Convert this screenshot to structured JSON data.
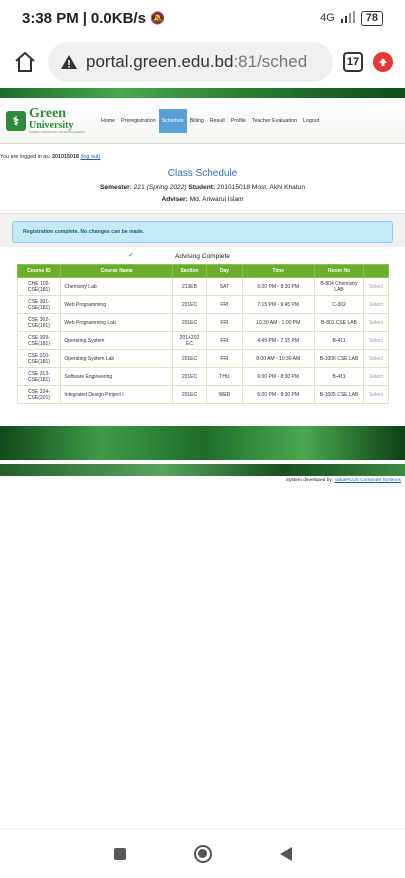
{
  "status": {
    "time": "3:38 PM",
    "speed": "0.0KB/s",
    "network": "4G",
    "battery": "78"
  },
  "browser": {
    "url_main": "portal.green.edu.bd",
    "url_rest": ":81/sched",
    "tab_count": "17"
  },
  "site": {
    "logo_name": "Green",
    "logo_name2": "University",
    "logo_tagline": "GREEN UNIVERSITY OF BANGLADESH",
    "nav": [
      {
        "label": "Home",
        "active": false
      },
      {
        "label": "Preregistration",
        "active": false
      },
      {
        "label": "Schedule",
        "active": true
      },
      {
        "label": "Billing",
        "active": false
      },
      {
        "label": "Result",
        "active": false
      },
      {
        "label": "Profile",
        "active": false
      },
      {
        "label": "Teacher Evaluation",
        "active": false
      },
      {
        "label": "Logout",
        "active": false
      }
    ],
    "login_prefix": "You are logged in as:",
    "user_id": "201015018",
    "logout_link": "(log out)"
  },
  "schedule": {
    "title": "Class Schedule",
    "semester_label": "Semester:",
    "semester_code": "221",
    "semester_name": "(Spring 2022)",
    "student_label": "Student:",
    "student": "201015018 Most. Akhi Khatun",
    "adviser_label": "Adviser:",
    "adviser": "Md. Anwarul Islam",
    "alert": "Registration complete. No changes can be made.",
    "advising_status": "Advising Complete",
    "columns": [
      "Course ID",
      "Course Name",
      "Section",
      "Day",
      "Time",
      "Room No",
      ""
    ],
    "rows": [
      {
        "id": "CHE 102-CSE(181)",
        "name": "Chemistry Lab",
        "section": "213EB",
        "day": "SAT",
        "time": "6:00 PM - 8:30 PM",
        "room": "B-804 Chemistry LAB",
        "action": "Select"
      },
      {
        "id": "CSE 301-CSE(181)",
        "name": "Web Programming",
        "section": "201EC",
        "day": "FRI",
        "time": "7:15 PM - 9:45 PM",
        "room": "C-302",
        "action": "Select"
      },
      {
        "id": "CSE 302-CSE(181)",
        "name": "Web Programming Lab",
        "section": "201EC",
        "day": "FRI",
        "time": "10:30 AM - 1:00 PM",
        "room": "B-801 CSE LAB",
        "action": "Select"
      },
      {
        "id": "CSE 309-CSE(181)",
        "name": "Operating System",
        "section": "201+202 EC",
        "day": "FRI",
        "time": "4:45 PM - 7:15 PM",
        "room": "B-411",
        "action": "Select"
      },
      {
        "id": "CSE 310-CSE(181)",
        "name": "Operating System Lab",
        "section": "201EC",
        "day": "FRI",
        "time": "8:00 AM - 10:30 AM",
        "room": "B-1006 CSE LAB",
        "action": "Select"
      },
      {
        "id": "CSE 313-CSE(181)",
        "name": "Software Engineering",
        "section": "201EC",
        "day": "THU",
        "time": "6:00 PM - 8:30 PM",
        "room": "B-411",
        "action": "Select"
      },
      {
        "id": "CSE 324-CSE(201)",
        "name": "Integrated Design Project I",
        "section": "201EC",
        "day": "WED",
        "time": "6:00 PM - 8:30 PM",
        "room": "B-1005 CSE LAB",
        "action": "Select"
      }
    ]
  },
  "footer": {
    "prefix": "System developed by:",
    "link": "ValuePLUS Computer Systems"
  },
  "colors": {
    "brand_green": "#2d8a38",
    "table_header": "#6cae2c",
    "nav_active": "#5aa0d8",
    "alert_bg": "#c5e9f7"
  }
}
